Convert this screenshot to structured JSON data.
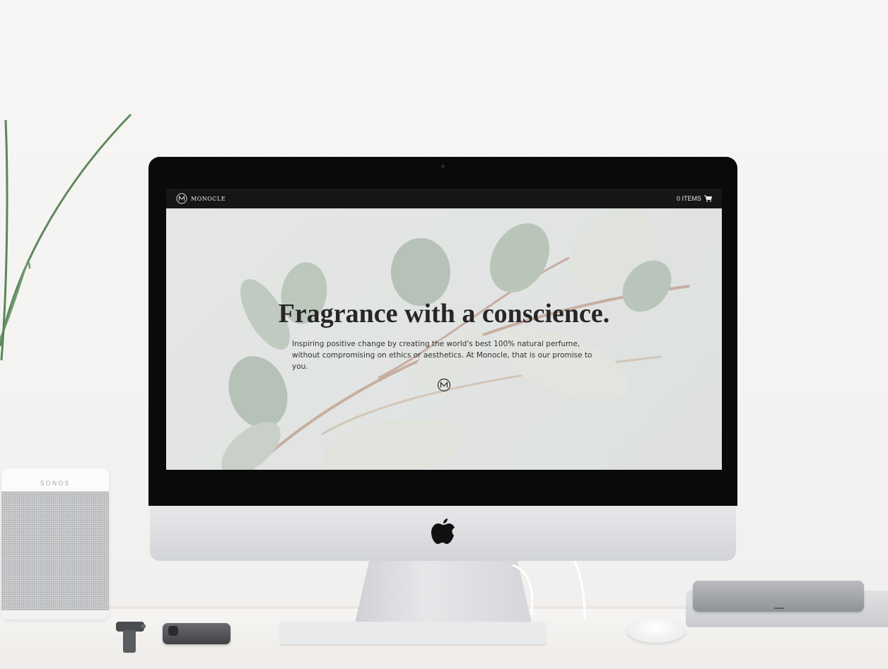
{
  "website": {
    "brand": "MONOCLE",
    "cart_label": "0 ITEMS",
    "hero": {
      "title": "Fragrance with a conscience.",
      "subtitle": "Inspiring positive change by creating the world's best 100% natural perfume, without compromising on ethics or aesthetics. At Monocle, that is our promise to you."
    }
  },
  "scene": {
    "speaker_label": "SONOS"
  },
  "colors": {
    "navbar_bg": "#161616",
    "hero_bg": "#dfe2e1",
    "title_text": "#262626",
    "leaf_green": "#9aab9b",
    "stem": "#b58a78"
  },
  "icons": {
    "brand_logo": "monogram-m-circle-icon",
    "cart": "shopping-cart-icon",
    "hero_mark": "monogram-m-circle-icon"
  }
}
